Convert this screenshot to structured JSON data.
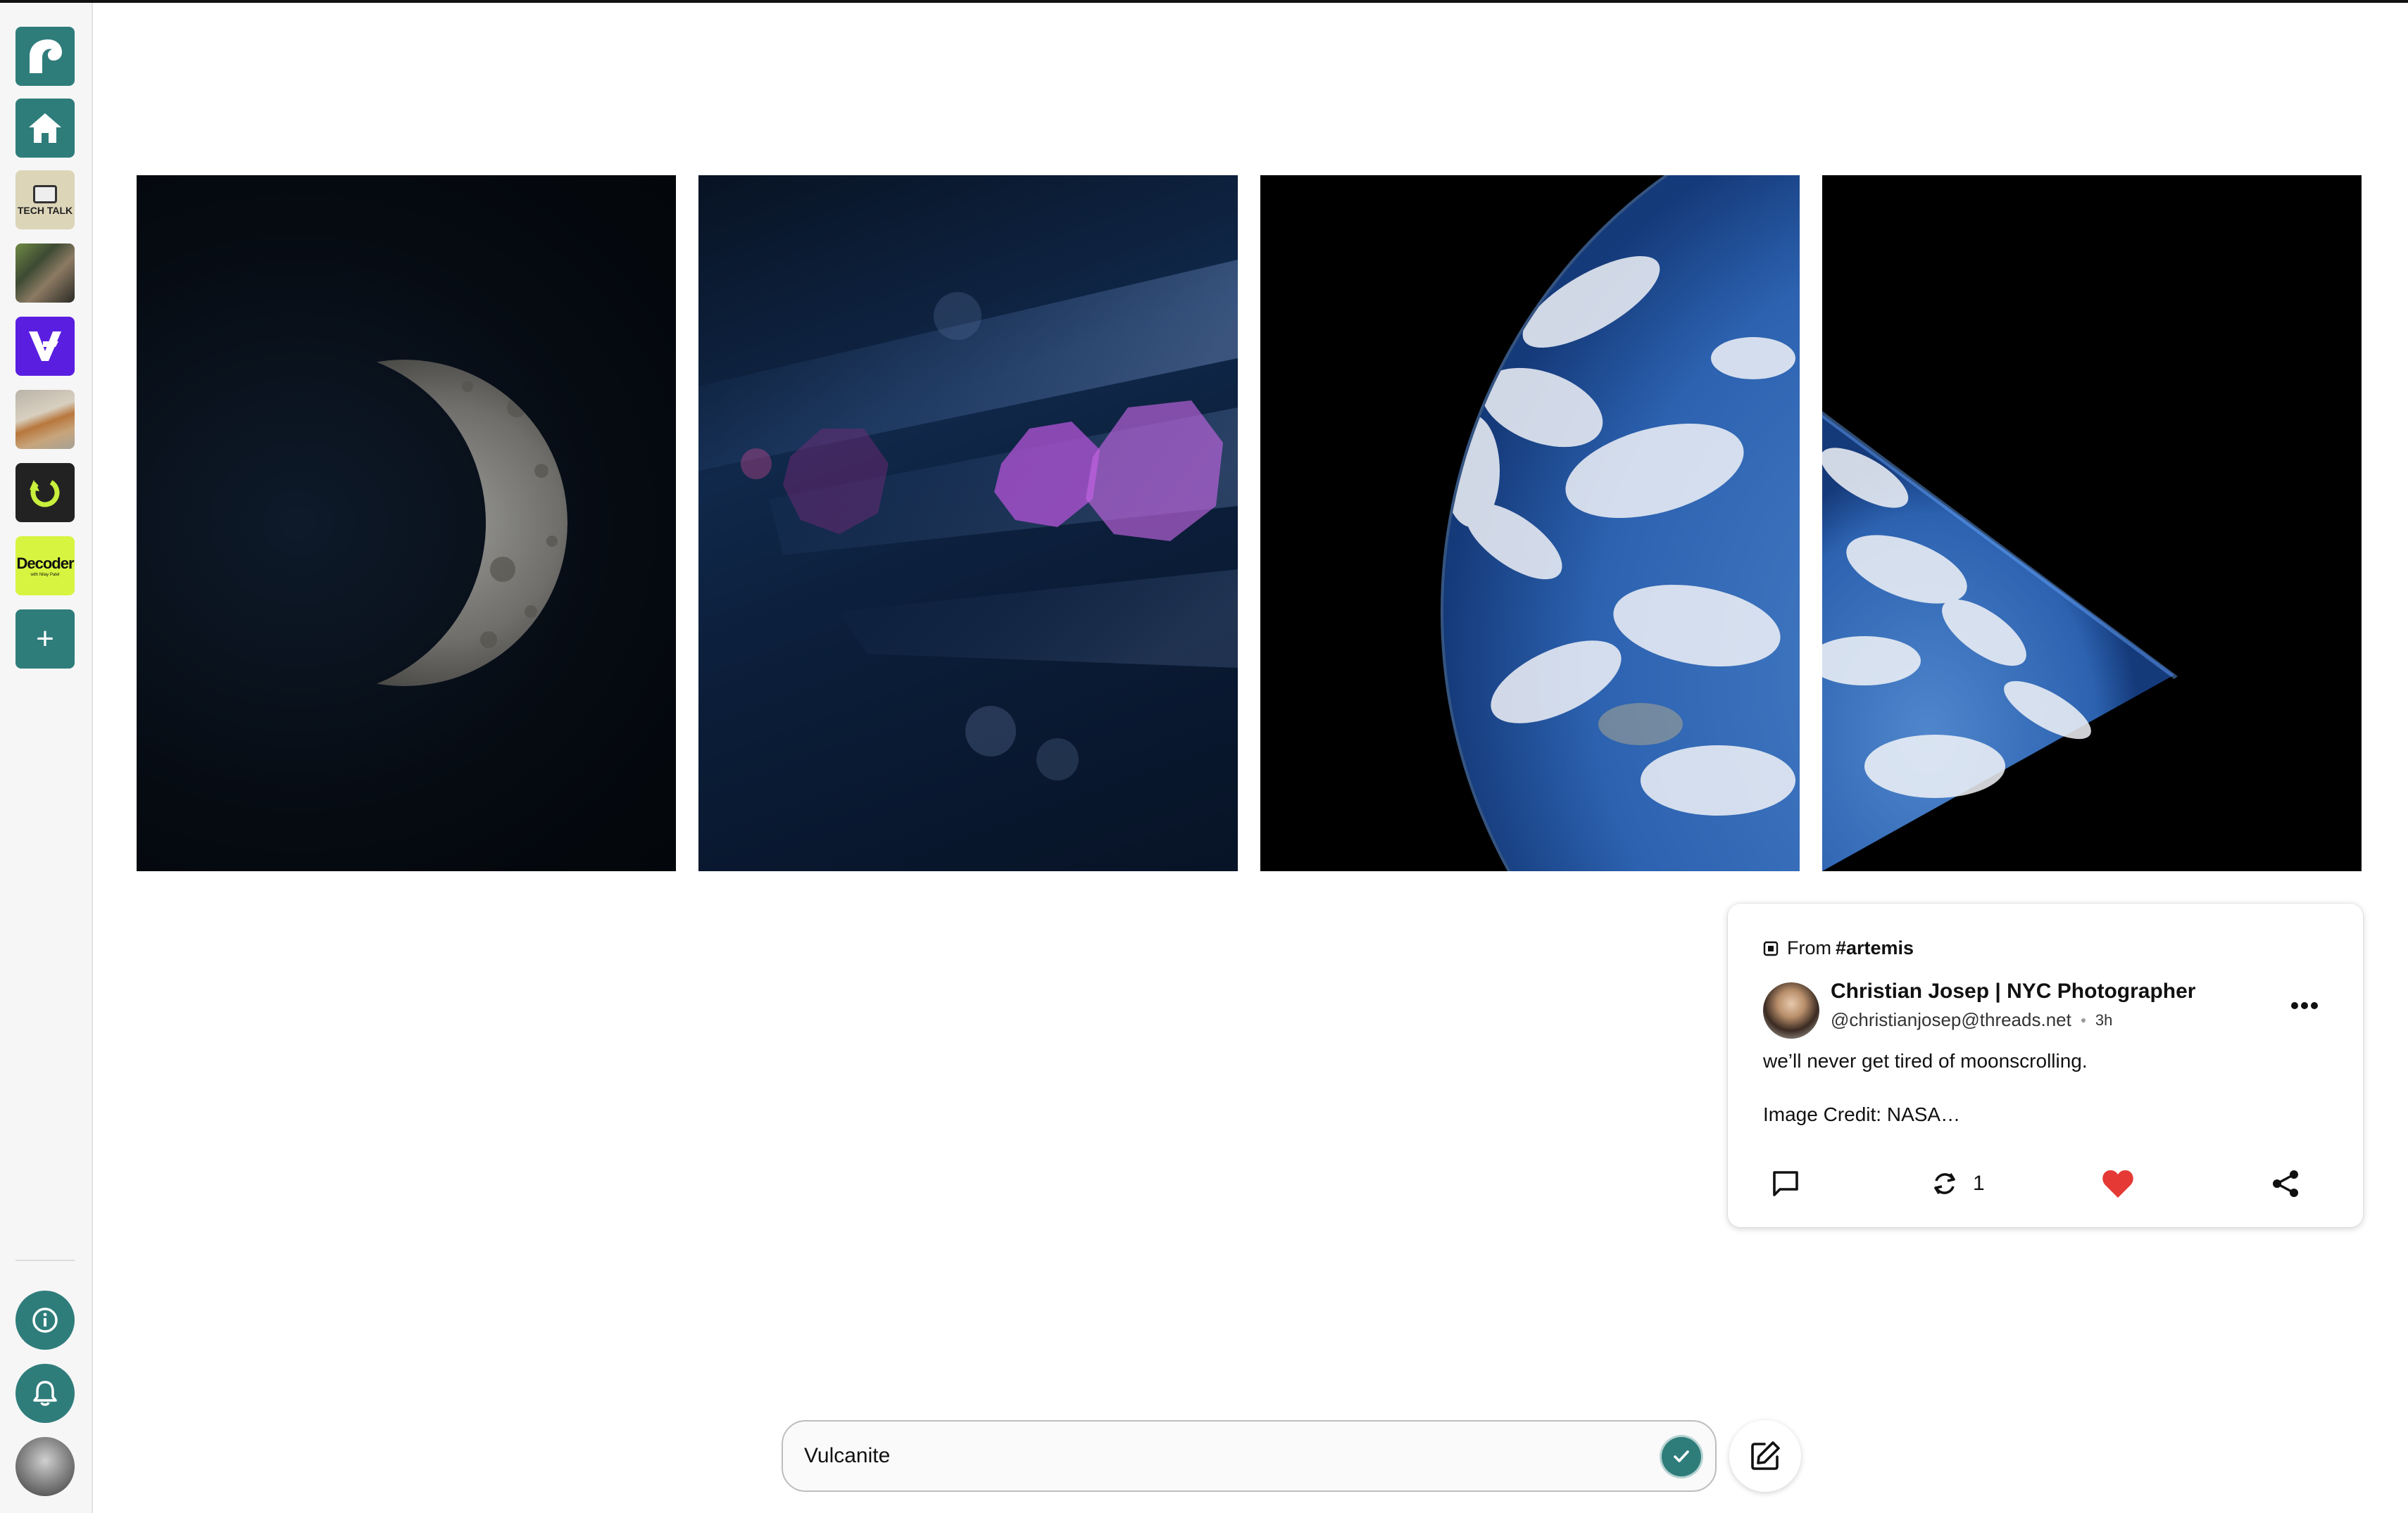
{
  "app": {
    "accent_color": "#2e7d7b"
  },
  "sidebar": {
    "items": [
      {
        "name": "app-logo",
        "icon": "wave-logo-icon"
      },
      {
        "name": "home",
        "icon": "home-icon"
      },
      {
        "name": "feed-tech-talk",
        "label": "TECH TALK"
      },
      {
        "name": "feed-photo",
        "icon": "photo-thumbnail"
      },
      {
        "name": "feed-the-verge",
        "label": "V"
      },
      {
        "name": "feed-dog",
        "icon": "dog-thumbnail"
      },
      {
        "name": "feed-green",
        "icon": "refresh-logo-icon"
      },
      {
        "name": "feed-decoder",
        "label": "Decoder",
        "sublabel": "with Nilay Patel"
      },
      {
        "name": "add-feed",
        "label": "+"
      }
    ],
    "bottom": [
      {
        "name": "info",
        "icon": "info-icon"
      },
      {
        "name": "notifications",
        "icon": "bell-icon"
      },
      {
        "name": "profile",
        "icon": "avatar"
      }
    ]
  },
  "post": {
    "from_prefix": "From",
    "from_tag": "#artemis",
    "author_name": "Christian Josep | NYC Photographer",
    "author_handle": "@christianjosep@threads.net",
    "time": "3h",
    "text": "we’ll never get tired of moonscrolling.",
    "credit": "Image Credit: NASA…",
    "repost_count": "1",
    "like_color": "#e53935"
  },
  "bottom_bar": {
    "feed_name": "Vulcanite"
  }
}
